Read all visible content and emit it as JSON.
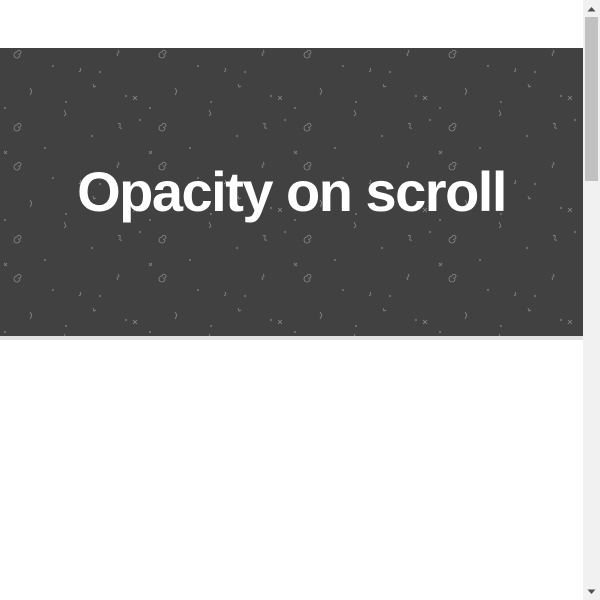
{
  "hero": {
    "title": "Opacity on scroll",
    "background_color": "#414141",
    "text_color": "#ffffff",
    "pattern_icons": [
      "spiral-doodle",
      "cross-doodle",
      "bracket-doodle",
      "squiggle-doodle",
      "dot"
    ]
  },
  "scrollbar": {
    "track_color": "#f1f1f1",
    "thumb_color": "#c1c1c1",
    "up_icon": "triangle-up-icon",
    "down_icon": "triangle-down-icon"
  }
}
